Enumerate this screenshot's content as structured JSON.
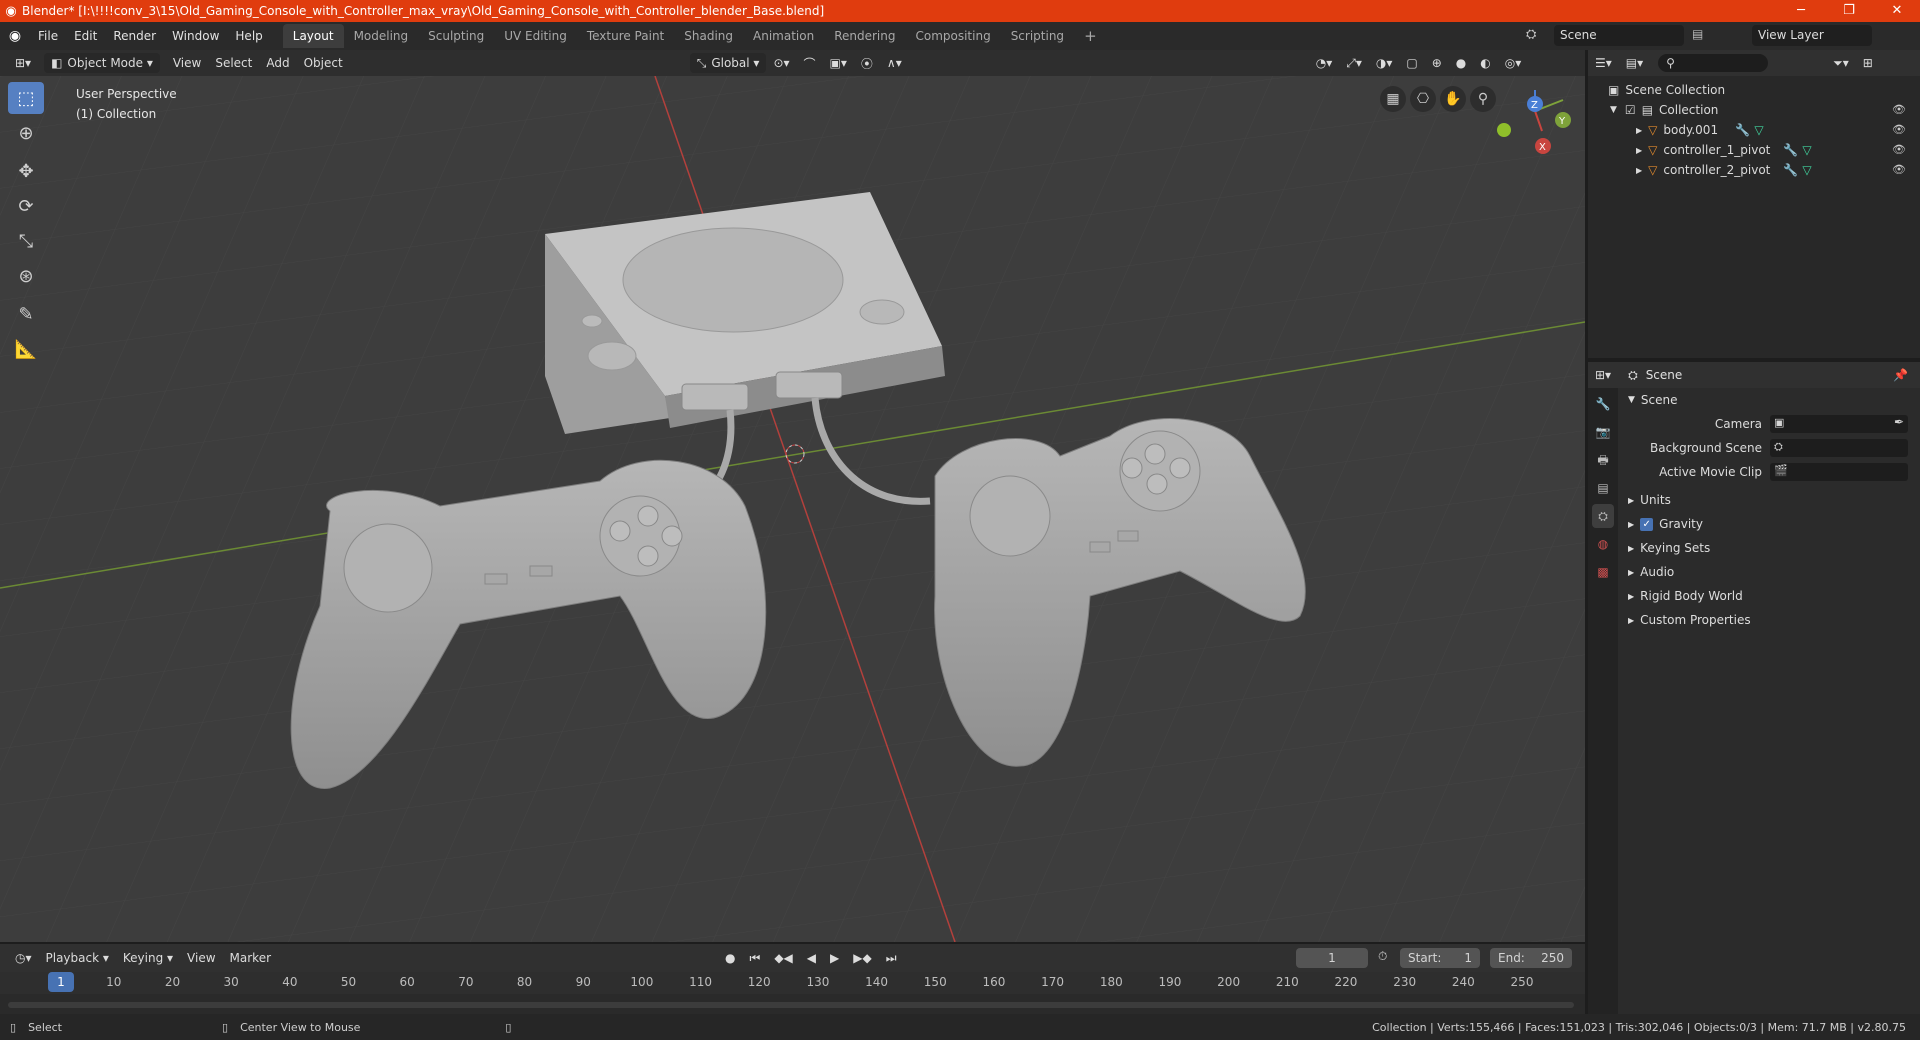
{
  "window": {
    "title": "Blender* [I:\\!!!!conv_3\\15\\Old_Gaming_Console_with_Controller_max_vray\\Old_Gaming_Console_with_Controller_blender_Base.blend]",
    "minimize": "─",
    "maximize": "❐",
    "close": "✕"
  },
  "menu": [
    "File",
    "Edit",
    "Render",
    "Window",
    "Help"
  ],
  "workspaces": [
    "Layout",
    "Modeling",
    "Sculpting",
    "UV Editing",
    "Texture Paint",
    "Shading",
    "Animation",
    "Rendering",
    "Compositing",
    "Scripting"
  ],
  "add_workspace": "+",
  "scene_field": "Scene",
  "view_layer_field": "View Layer",
  "viewport_header": {
    "mode": "Object Mode",
    "menus": [
      "View",
      "Select",
      "Add",
      "Object"
    ],
    "orientation": "Global"
  },
  "viewport": {
    "perspective": "User Perspective",
    "collection": "(1) Collection",
    "gizmo": {
      "z": "Z",
      "y": "Y",
      "x": "X"
    }
  },
  "outliner": {
    "root": "Scene Collection",
    "collection": "Collection",
    "items": [
      "body.001",
      "controller_1_pivot",
      "controller_2_pivot"
    ]
  },
  "properties": {
    "header": "Scene",
    "section": "Scene",
    "fields": [
      "Camera",
      "Background Scene",
      "Active Movie Clip"
    ],
    "subsections": [
      "Units",
      "Gravity",
      "Keying Sets",
      "Audio",
      "Rigid Body World",
      "Custom Properties"
    ]
  },
  "timeline": {
    "menus": [
      "Playback",
      "Keying",
      "View",
      "Marker"
    ],
    "current_frame": "1",
    "start_label": "Start:",
    "start": "1",
    "end_label": "End:",
    "end": "250",
    "ruler": [
      "1",
      "10",
      "20",
      "30",
      "40",
      "50",
      "60",
      "70",
      "80",
      "90",
      "100",
      "110",
      "120",
      "130",
      "140",
      "150",
      "160",
      "170",
      "180",
      "190",
      "200",
      "210",
      "220",
      "230",
      "240",
      "250"
    ]
  },
  "status": {
    "select": "Select",
    "center": "Center View to Mouse",
    "stats": "Collection | Verts:155,466 | Faces:151,023 | Tris:302,046 | Objects:0/3 | Mem: 71.7 MB | v2.80.75"
  },
  "colors": {
    "title_bar": "#e03c0e",
    "accent": "#5680c2",
    "x_axis": "#c8453f",
    "y_axis": "#7ea23a",
    "object_orange": "#e08a2e"
  }
}
